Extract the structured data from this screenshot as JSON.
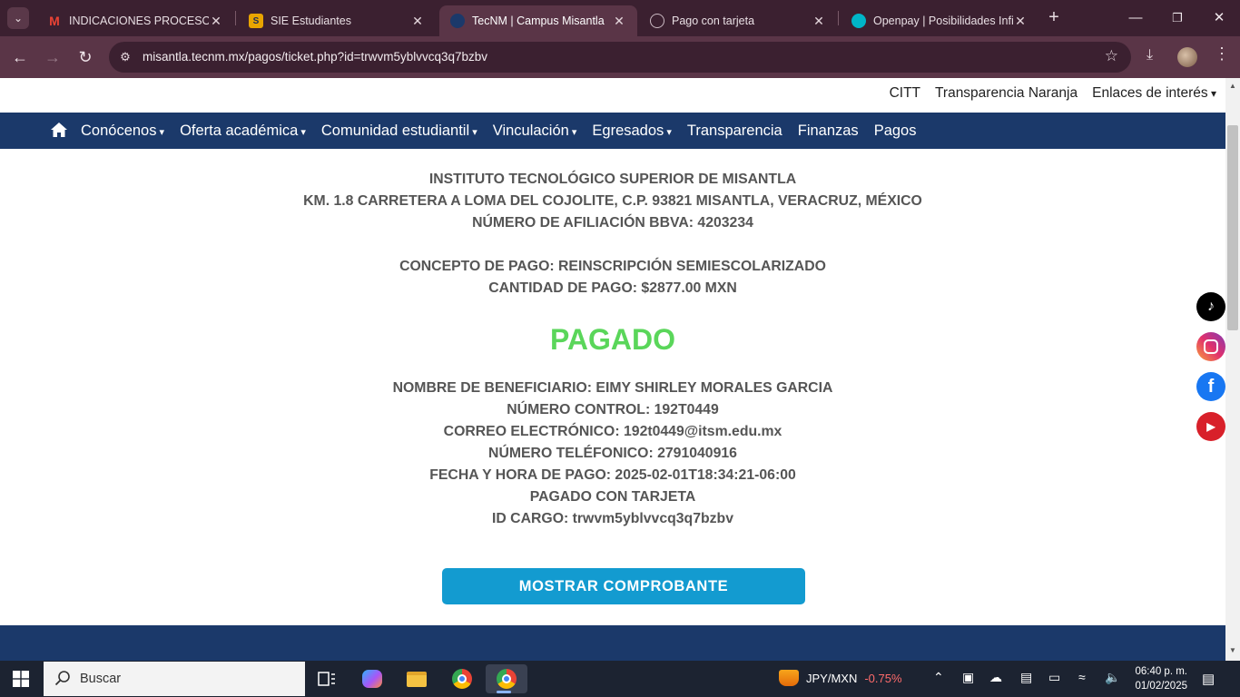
{
  "browser": {
    "tabs": [
      {
        "title": "INDICACIONES PROCESO DE",
        "icon": "gmail-icon"
      },
      {
        "title": "SIE Estudiantes",
        "icon": "sie-icon"
      },
      {
        "title": "TecNM | Campus Misantla",
        "icon": "tecnm-icon",
        "active": true
      },
      {
        "title": "Pago con tarjeta",
        "icon": "globe-icon"
      },
      {
        "title": "Openpay | Posibilidades Infin",
        "icon": "openpay-icon"
      }
    ],
    "url": "misantla.tecnm.mx/pagos/ticket.php?id=trwvm5yblvvcq3q7bzbv"
  },
  "site": {
    "top_links": [
      "CITT",
      "Transparencia Naranja",
      "Enlaces de interés"
    ],
    "nav": [
      "Conócenos",
      "Oferta académica",
      "Comunidad estudiantil",
      "Vinculación",
      "Egresados",
      "Transparencia",
      "Finanzas",
      "Pagos"
    ]
  },
  "ticket": {
    "institution": "INSTITUTO TECNOLÓGICO SUPERIOR DE MISANTLA",
    "address": "KM. 1.8 CARRETERA A LOMA DEL COJOLITE, C.P. 93821 MISANTLA, VERACRUZ, MÉXICO",
    "affiliation": "NÚMERO DE AFILIACIÓN BBVA: 4203234",
    "concept": "CONCEPTO DE PAGO: REINSCRIPCIÓN SEMIESCOLARIZADO",
    "amount": "CANTIDAD DE PAGO: $2877.00 MXN",
    "status": "PAGADO",
    "status_color": "#5ad65a",
    "beneficiary": "NOMBRE DE BENEFICIARIO: EIMY SHIRLEY MORALES GARCIA",
    "control_number": "NÚMERO CONTROL: 192T0449",
    "email": "CORREO ELECTRÓNICO: 192t0449@itsm.edu.mx",
    "phone": "NÚMERO TELÉFONICO: 2791040916",
    "datetime": "FECHA Y HORA DE PAGO: 2025-02-01T18:34:21-06:00",
    "method": "PAGADO CON TARJETA",
    "charge_id": "ID CARGO: trwvm5yblvvcq3q7bzbv",
    "button": "MOSTRAR COMPROBANTE"
  },
  "social": [
    "tiktok-icon",
    "instagram-icon",
    "facebook-icon",
    "youtube-icon"
  ],
  "taskbar": {
    "search_placeholder": "Buscar",
    "ticker_symbol": "JPY/MXN",
    "ticker_change": "-0.75%",
    "time": "06:40 p. m.",
    "date": "01/02/2025"
  },
  "colors": {
    "nav_blue": "#1b396a",
    "button_blue": "#139bd0",
    "browser_frame": "#3b2030"
  }
}
